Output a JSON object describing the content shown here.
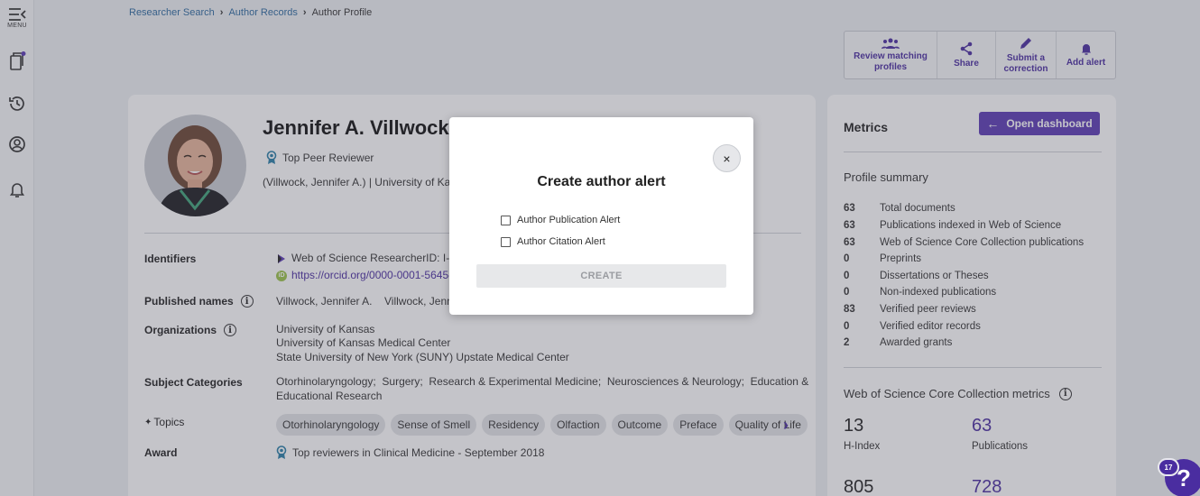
{
  "rail": {
    "menu_label": "MENU"
  },
  "breadcrumb": [
    "Researcher Search",
    "Author Records",
    "Author Profile"
  ],
  "actions": [
    {
      "label": "Review matching profiles",
      "icon": "people-icon"
    },
    {
      "label": "Share",
      "icon": "share-icon"
    },
    {
      "label": "Submit a correction",
      "icon": "pencil-icon"
    },
    {
      "label": "Add alert",
      "icon": "bell-icon"
    }
  ],
  "profile": {
    "name": "Jennifer A. Villwock",
    "badge": "Top Peer Reviewer",
    "affiliation_line": "(Villwock, Jennifer A.) | University of Kansas",
    "identifiers_label": "Identifiers",
    "researcher_id": "Web of Science ResearcherID: I-418",
    "orcid": "https://orcid.org/0000-0001-5645-4",
    "published_names_label": "Published names",
    "published_names": [
      "Villwock, Jennifer A.",
      "Villwock, Jenn"
    ],
    "organizations_label": "Organizations",
    "organizations": [
      "University of Kansas",
      "University of Kansas Medical Center",
      "State University of New York (SUNY) Upstate Medical Center"
    ],
    "subject_label": "Subject Categories",
    "subjects_line1": "Otorhinolaryngology;  Surgery;  Research & Experimental Medicine;  Neurosciences & Neurology;  Education &",
    "subjects_line2": "Educational Research",
    "topics_label": "Topics",
    "topics": [
      "Otorhinolaryngology",
      "Sense of Smell",
      "Residency",
      "Olfaction",
      "Outcome",
      "Preface",
      "Quality of Life"
    ],
    "award_label": "Award",
    "award": "Top reviewers in Clinical Medicine - September 2018"
  },
  "metrics": {
    "title": "Metrics",
    "dashboard_button": "Open dashboard",
    "summary_title": "Profile summary",
    "summary": [
      {
        "n": "63",
        "label": "Total documents"
      },
      {
        "n": "63",
        "label": "Publications indexed in Web of Science"
      },
      {
        "n": "63",
        "label": "Web of Science Core Collection publications"
      },
      {
        "n": "0",
        "label": "Preprints"
      },
      {
        "n": "0",
        "label": "Dissertations or Theses"
      },
      {
        "n": "0",
        "label": "Non-indexed publications"
      },
      {
        "n": "83",
        "label": "Verified peer reviews"
      },
      {
        "n": "0",
        "label": "Verified editor records"
      },
      {
        "n": "2",
        "label": "Awarded grants"
      }
    ],
    "core_title": "Web of Science Core Collection metrics",
    "h_index": "13",
    "h_index_label": "H-Index",
    "publications": "63",
    "publications_label": "Publications",
    "sum_times_cited": "805",
    "citing_articles": "728"
  },
  "modal": {
    "title": "Create author alert",
    "options": [
      "Author Publication Alert",
      "Author Citation Alert"
    ],
    "create_label": "CREATE",
    "close_label": "×"
  },
  "help": {
    "count": "17",
    "label": "?"
  }
}
